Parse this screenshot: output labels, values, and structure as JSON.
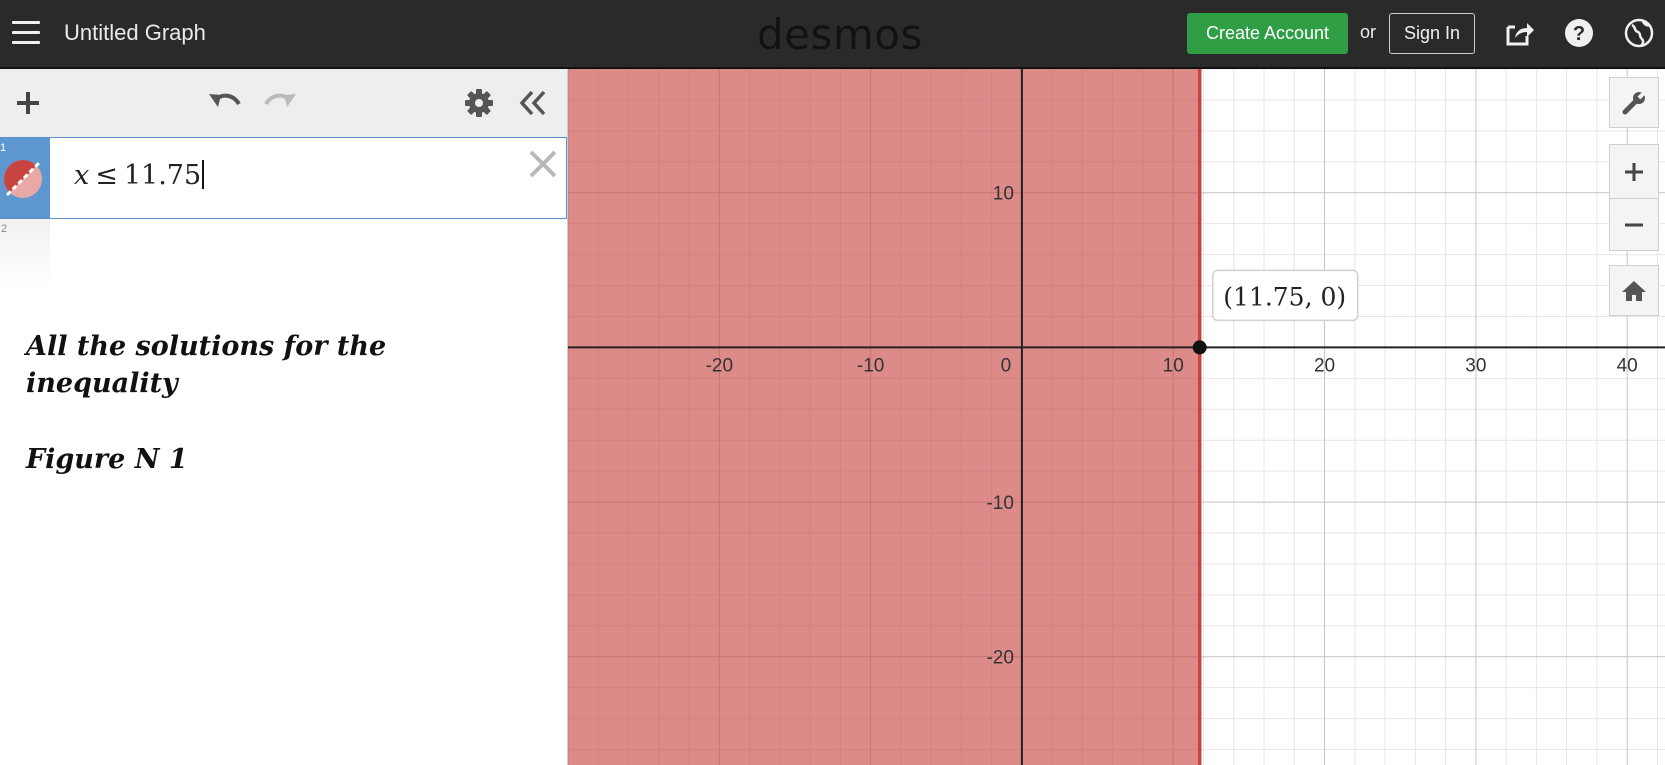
{
  "header": {
    "title": "Untitled Graph",
    "brand": "desmos",
    "create_account": "Create Account",
    "or": "or",
    "sign_in": "Sign In",
    "icons": [
      "menu-icon",
      "share-icon",
      "help-icon",
      "language-globe-icon"
    ]
  },
  "panel": {
    "toolbar_icons": [
      "add-icon",
      "undo-icon",
      "redo-icon",
      "settings-gear-icon",
      "collapse-panel-icon"
    ],
    "expressions": [
      {
        "number": "1",
        "parts": {
          "var": "x",
          "op": "≤",
          "value": "11.75"
        },
        "color": "#c74440"
      },
      {
        "number": "2",
        "parts": null
      }
    ],
    "notes": {
      "line1": "All the solutions for the",
      "line2": "inequality",
      "line3": "Figure N 1"
    }
  },
  "graph": {
    "shade_color": "#c74440",
    "point_label": "(11.75, 0)",
    "control_icons": [
      "wrench-icon",
      "zoom-in-icon",
      "zoom-out-icon",
      "home-icon"
    ]
  },
  "chart_data": {
    "type": "scatter",
    "title": "",
    "inequality": "x ≤ 11.75",
    "boundary_x": 11.75,
    "shaded_region": "x <= 11.75",
    "points": [
      {
        "x": 11.75,
        "y": 0,
        "label": "(11.75, 0)"
      }
    ],
    "xlim": [
      -30,
      42.5
    ],
    "ylim": [
      -27,
      18
    ],
    "x_ticks": [
      -20,
      -10,
      0,
      10,
      20,
      30,
      40
    ],
    "y_ticks": [
      -20,
      -10,
      10
    ],
    "x_tick_labels": [
      "-20",
      "-10",
      "0",
      "10",
      "20",
      "30",
      "40"
    ],
    "y_tick_labels": [
      "-20",
      "-10",
      "10"
    ],
    "grid": true
  }
}
